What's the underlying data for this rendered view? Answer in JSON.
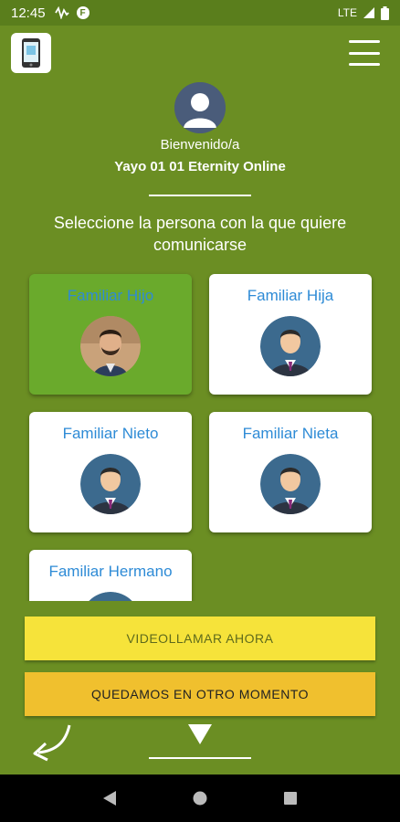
{
  "status_bar": {
    "time": "12:45",
    "network": "LTE"
  },
  "header": {
    "welcome": "Bienvenido/a",
    "username": "Yayo 01 01 Eternity Online"
  },
  "instruction": "Seleccione la persona con la que quiere comunicarse",
  "contacts": [
    {
      "label": "Familiar Hijo",
      "selected": true
    },
    {
      "label": "Familiar Hija",
      "selected": false
    },
    {
      "label": "Familiar Nieto",
      "selected": false
    },
    {
      "label": "Familiar Nieta",
      "selected": false
    },
    {
      "label": "Familiar Hermano",
      "selected": false
    }
  ],
  "buttons": {
    "call_now": "VIDEOLLAMAR AHORA",
    "later": "QUEDAMOS EN OTRO MOMENTO"
  },
  "colors": {
    "background": "#6b8e23",
    "selected_card": "#6aaa2c",
    "label_blue": "#2e8bd6",
    "primary_button": "#f6e33a",
    "secondary_button": "#f0c02e"
  }
}
